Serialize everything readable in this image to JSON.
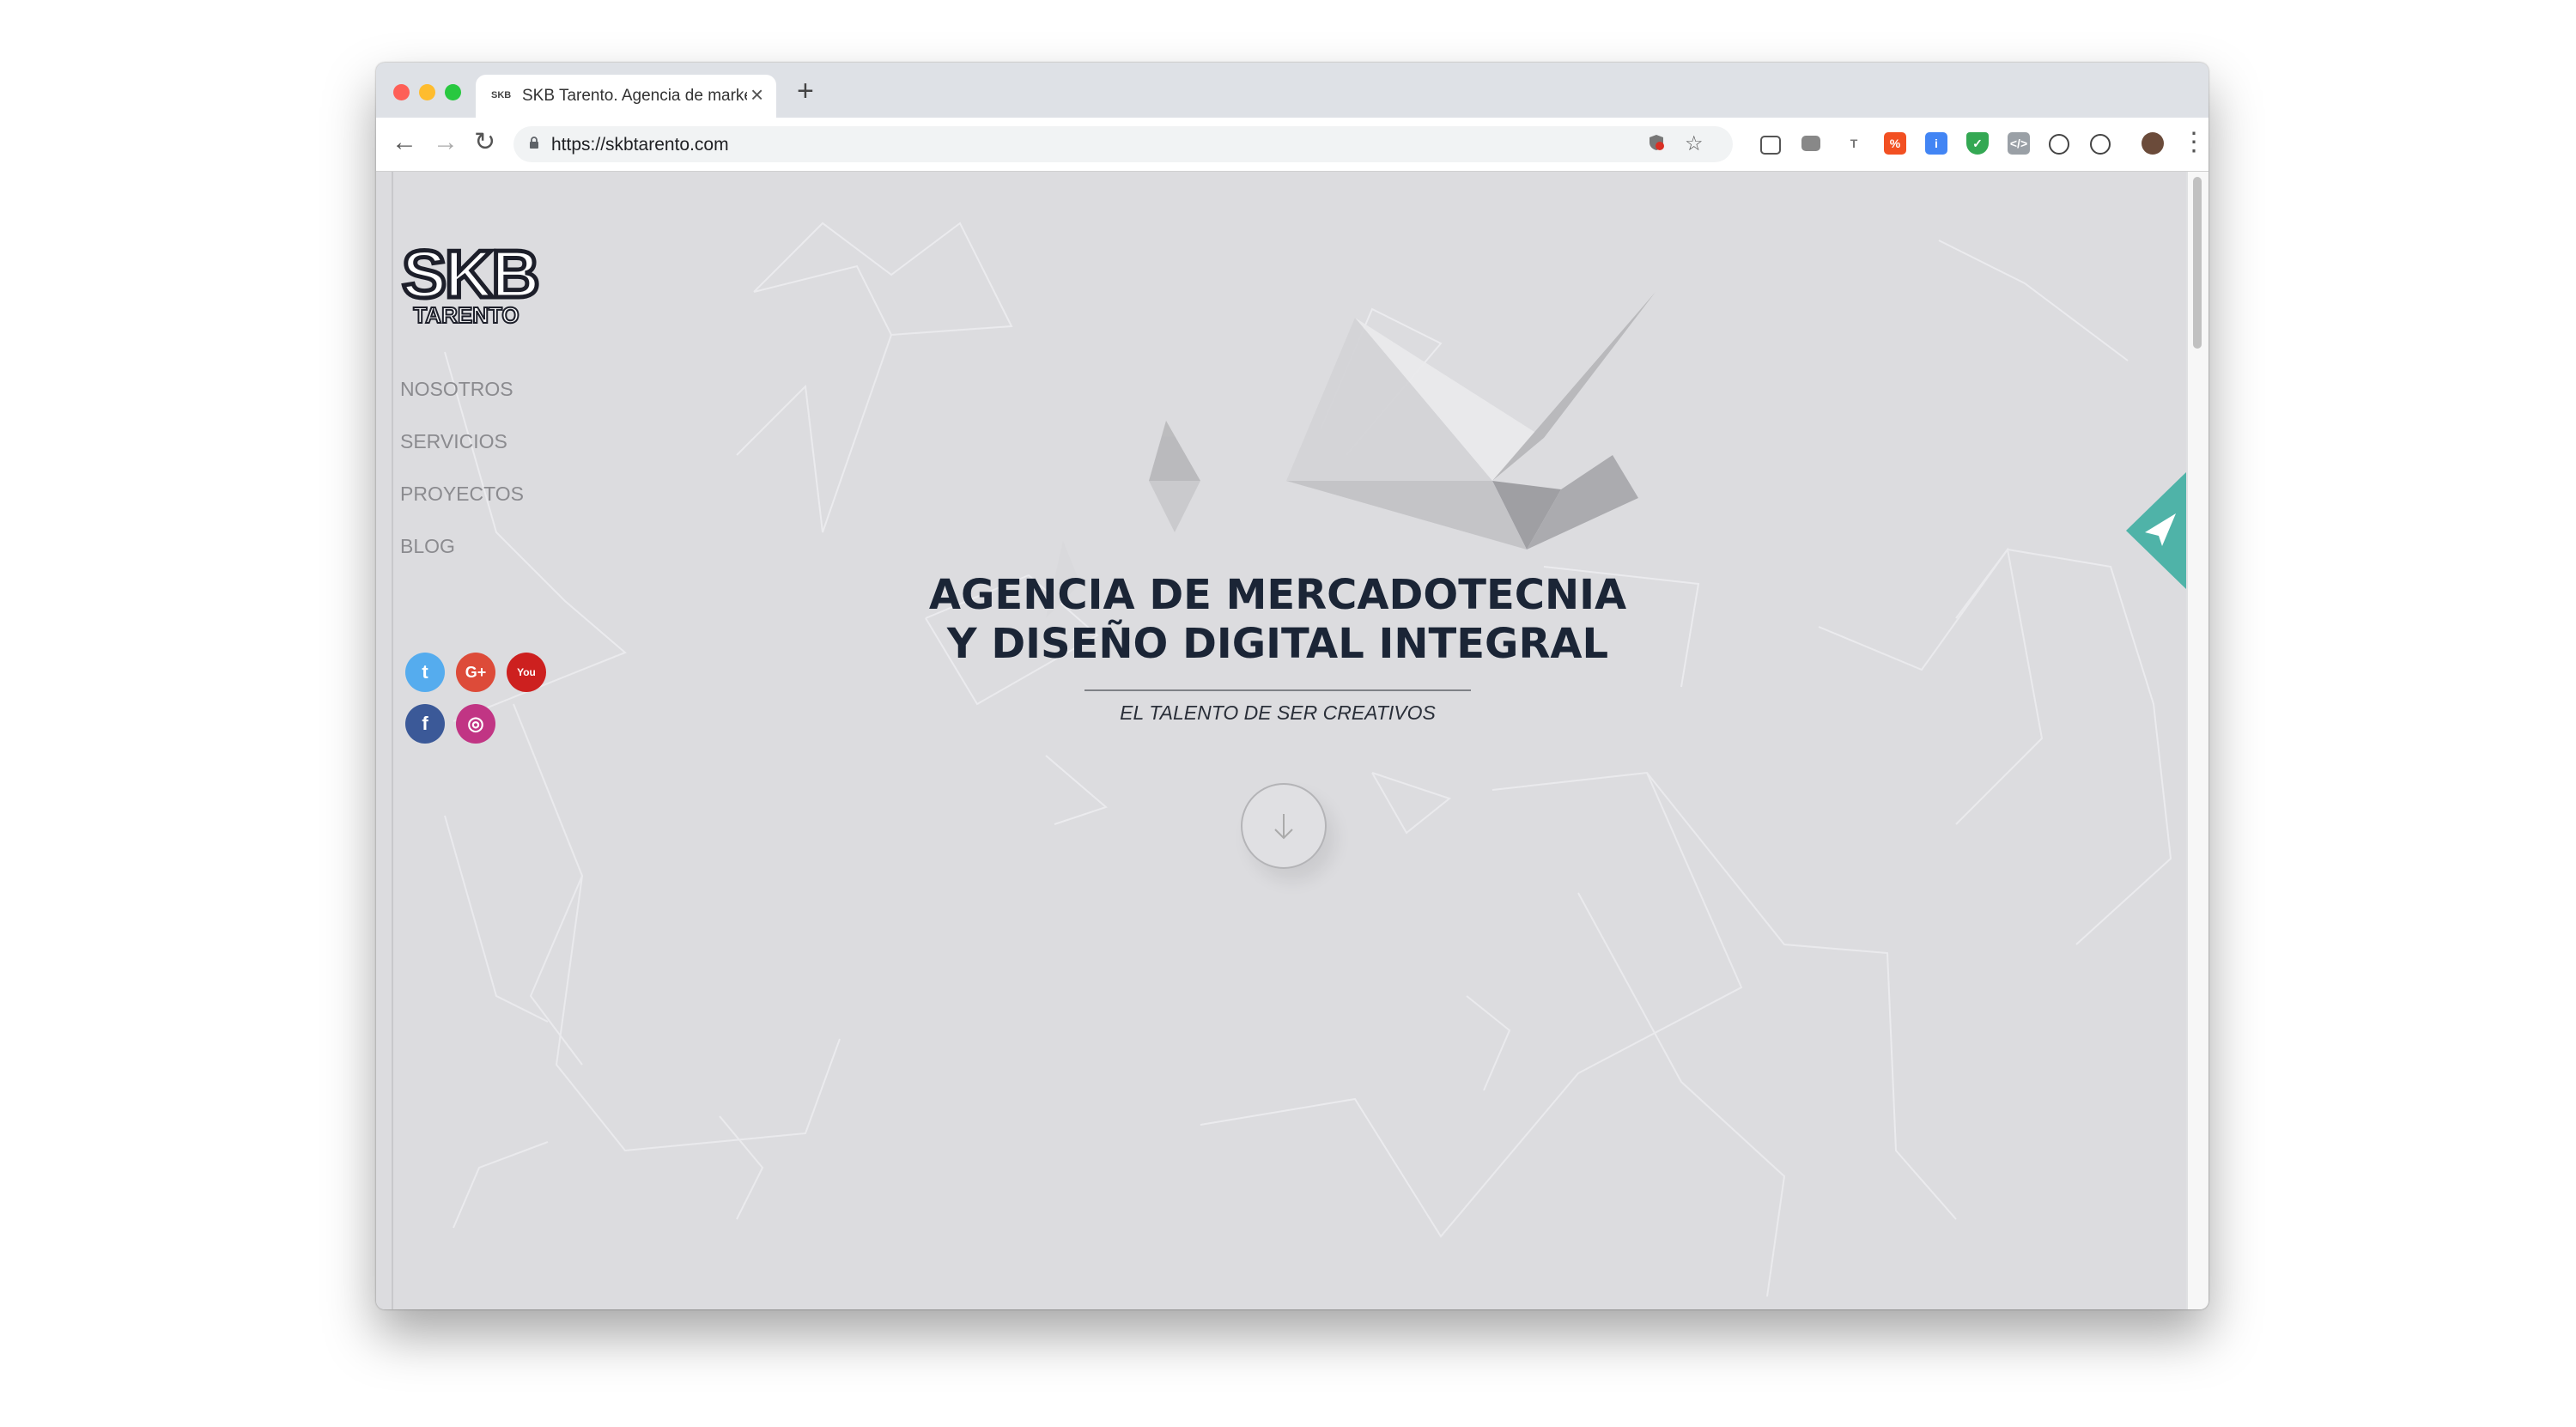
{
  "browser": {
    "tab_title": "SKB Tarento. Agencia de marketing",
    "tab_favicon_text": "SKB",
    "close_glyph": "×",
    "new_tab_glyph": "+",
    "url": "https://skbtarento.com",
    "back_glyph": "←",
    "forward_glyph": "→",
    "reload_glyph": "↻",
    "star_glyph": "☆",
    "menu_glyph": "⋮"
  },
  "site": {
    "logo": {
      "main": "SKB",
      "sub": "TARENTO"
    },
    "menu": [
      "NOSOTROS",
      "SERVICIOS",
      "PROYECTOS",
      "BLOG"
    ],
    "social": [
      {
        "name": "twitter",
        "glyph": "t",
        "color": "#55acee"
      },
      {
        "name": "google-plus",
        "glyph": "G+",
        "color": "#dd4b39"
      },
      {
        "name": "youtube",
        "glyph": "You",
        "color": "#cd201f"
      },
      {
        "name": "facebook",
        "glyph": "f",
        "color": "#3b5998"
      },
      {
        "name": "instagram",
        "glyph": "◎",
        "color": "#c13584"
      }
    ],
    "hero": {
      "title_line1": "AGENCIA DE MERCADOTECNIA",
      "title_line2": "Y DISEÑO DIGITAL INTEGRAL",
      "subtitle": "EL TALENTO DE SER CREATIVOS"
    },
    "scroll_glyph": "↓",
    "colors": {
      "accent": "#4fb3a8",
      "title": "#1b2536",
      "menu": "#8b8b8f",
      "background": "#dcdcdf"
    }
  }
}
